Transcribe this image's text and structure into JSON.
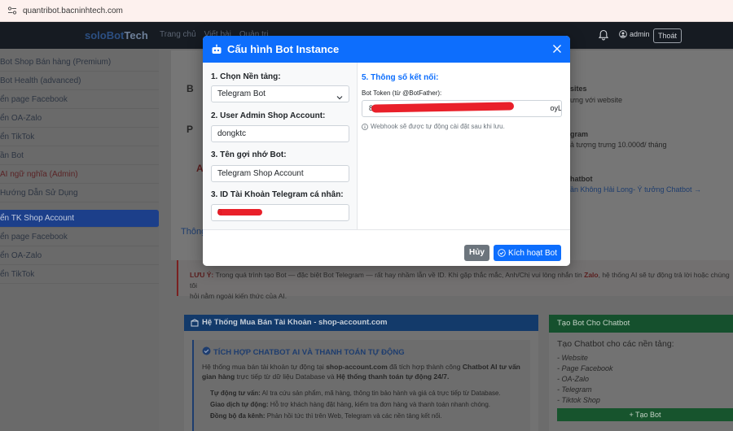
{
  "browser": {
    "url": "quantribot.bacninhtech.com"
  },
  "topnav": {
    "brand_a": "soloBot",
    "brand_b": "Tech",
    "links": [
      "Trang chủ",
      "Viết bài",
      "Quản trị"
    ],
    "admin_label": "admin",
    "logout_label": "Thoát"
  },
  "sidebar": {
    "items": [
      "Bot Shop Bán hàng (Premium)",
      "Bot Health (advanced)",
      "ển page Facebook",
      "ển OA-Zalo",
      "ển TikTok",
      "ần Bot",
      "AI ngữ nghĩa (Admin)",
      "Hướng Dẫn Sử Dụng",
      "ển TK Shop Account",
      "ển page Facebook",
      "ển OA-Zalo",
      "ển TikTok"
    ]
  },
  "background": {
    "card1_title": "B",
    "card2_title": "P",
    "card3_title": "A",
    "sites_title": "sites",
    "sites_sub": "ưng với website",
    "gram_title": "gram",
    "gram_sub": "ả tượng trưng 10.000đ/ tháng",
    "chatbot_title": "hatbot",
    "chatbot_link": "ần Không Hải Long- Ý tưởng Chatbot →",
    "tab_label": "Thông",
    "notice_prefix": "LƯU Ý:",
    "notice_text": "Trong quá trình tạo Bot — đặc biệt Bot Telegram — rất hay nhầm lẫn về ID. Khi gặp thắc mắc, Anh/Chị vui lòng nhắn tin",
    "notice_zalo": "Zalo",
    "notice_text2": ", hệ thống AI sẽ tự động trả lời hoặc chúng tôi",
    "notice_line2": "hỏi nằm ngoài kiến thức của AI.",
    "panel_title": "Hệ Thống Mua Bán Tài Khoản - shop-account.com",
    "integration_title": "TÍCH HỢP CHATBOT AI VÀ THANH TOÁN TỰ ĐỘNG",
    "desc_1": "Hệ thống mua bán tài khoản tự động tại",
    "desc_site": "shop-account.com",
    "desc_2": "đã tích hợp thành công",
    "desc_bold": "Chatbot AI tư vấn",
    "desc_3": "gian hàng",
    "desc_4": "trực tiếp từ dữ liệu Database và",
    "desc_bold2": "Hệ thống thanh toán tự động 24/7.",
    "bullet_1_b": "Tự động tư vấn:",
    "bullet_1": "AI tra cứu sản phẩm, mã hàng, thông tin bảo hành và giá cả trực tiếp từ Database.",
    "bullet_2_b": "Giao dịch tự động:",
    "bullet_2": "Hỗ trợ khách hàng đặt hàng, kiểm tra đơn hàng và thanh toán nhanh chóng.",
    "bullet_3_b": "Đồng bộ đa kênh:",
    "bullet_3": "Phản hồi tức thì trên Web, Telegram và các nền tảng kết nối.",
    "green_title": "Tạo Bot Cho Chatbot",
    "green_heading": "Tạo Chatbot cho các nền tảng:",
    "green_items": [
      "- Website",
      "- Page Facebook",
      "- OA-Zalo",
      "- Telegram",
      "- Tiktok Shop"
    ],
    "green_button": "+ Tạo Bot"
  },
  "modal": {
    "title": "Cấu hình Bot Instance",
    "platform_label": "1. Chọn Nền tảng:",
    "platform_value": "Telegram Bot",
    "admin_label": "2. User Admin Shop Account:",
    "admin_value": "dongktc",
    "nickname_label": "3. Tên gợi nhớ Bot:",
    "nickname_value": "Telegram Shop Account",
    "telegram_id_label": "3. ID Tài Khoản Telegram cá nhân:",
    "telegram_id_value": "8",
    "connection_heading": "5. Thông số kết nối:",
    "token_label": "Bot Token (từ @BotFather):",
    "token_value": "8                                                                                       oyLx§",
    "webhook_hint": "Webhook sẽ được tự động cài đặt sau khi lưu.",
    "cancel_label": "Hủy",
    "activate_label": "Kích hoạt Bot"
  },
  "colors": {
    "primary": "#0d6efd",
    "secondary": "#6c757d",
    "redaction": "#e8141f"
  }
}
